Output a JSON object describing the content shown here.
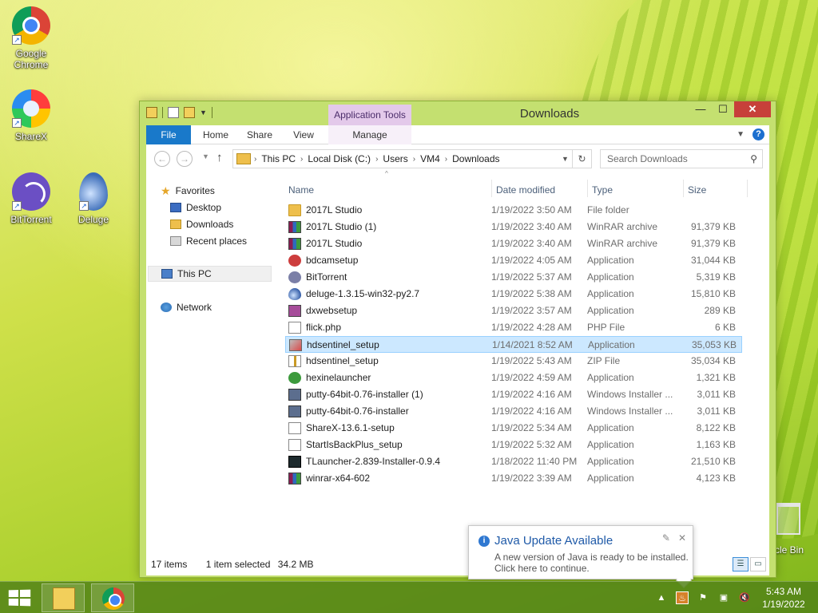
{
  "desktop": {
    "icons": [
      {
        "label": "Google\nChrome",
        "icon": "chrome-icon"
      },
      {
        "label": "ShareX",
        "icon": "sharex-icon"
      },
      {
        "label": "BitTorrent",
        "icon": "bittorrent-icon"
      },
      {
        "label": "Deluge",
        "icon": "deluge-icon"
      }
    ],
    "recycle_bin_label": "cle Bin"
  },
  "window": {
    "title": "Downloads",
    "context_tab": "Application Tools",
    "ribbon_tabs": [
      "File",
      "Home",
      "Share",
      "View",
      "Manage"
    ],
    "address_crumbs": [
      "This PC",
      "Local Disk (C:)",
      "Users",
      "VM4",
      "Downloads"
    ],
    "search_placeholder": "Search Downloads",
    "nav": {
      "favorites": "Favorites",
      "desktop": "Desktop",
      "downloads": "Downloads",
      "recent": "Recent places",
      "thispc": "This PC",
      "network": "Network"
    },
    "columns": [
      "Name",
      "Date modified",
      "Type",
      "Size"
    ],
    "files": [
      {
        "name": "2017L Studio",
        "date": "1/19/2022 3:50 AM",
        "type": "File folder",
        "size": "",
        "icon": "folder"
      },
      {
        "name": "2017L Studio (1)",
        "date": "1/19/2022 3:40 AM",
        "type": "WinRAR archive",
        "size": "91,379 KB",
        "icon": "rar"
      },
      {
        "name": "2017L Studio",
        "date": "1/19/2022 3:40 AM",
        "type": "WinRAR archive",
        "size": "91,379 KB",
        "icon": "rar"
      },
      {
        "name": "bdcamsetup",
        "date": "1/19/2022 4:05 AM",
        "type": "Application",
        "size": "31,044 KB",
        "icon": "app"
      },
      {
        "name": "BitTorrent",
        "date": "1/19/2022 5:37 AM",
        "type": "Application",
        "size": "5,319 KB",
        "icon": "bt"
      },
      {
        "name": "deluge-1.3.15-win32-py2.7",
        "date": "1/19/2022 5:38 AM",
        "type": "Application",
        "size": "15,810 KB",
        "icon": "drop"
      },
      {
        "name": "dxwebsetup",
        "date": "1/19/2022 3:57 AM",
        "type": "Application",
        "size": "289 KB",
        "icon": "dx"
      },
      {
        "name": "flick.php",
        "date": "1/19/2022 4:28 AM",
        "type": "PHP File",
        "size": "6 KB",
        "icon": "doc"
      },
      {
        "name": "hdsentinel_setup",
        "date": "1/14/2021 8:52 AM",
        "type": "Application",
        "size": "35,053 KB",
        "icon": "hd",
        "selected": true
      },
      {
        "name": "hdsentinel_setup",
        "date": "1/19/2022 5:43 AM",
        "type": "ZIP File",
        "size": "35,034 KB",
        "icon": "zip"
      },
      {
        "name": "hexinelauncher",
        "date": "1/19/2022 4:59 AM",
        "type": "Application",
        "size": "1,321 KB",
        "icon": "hex"
      },
      {
        "name": "putty-64bit-0.76-installer (1)",
        "date": "1/19/2022 4:16 AM",
        "type": "Windows Installer ...",
        "size": "3,011 KB",
        "icon": "msi"
      },
      {
        "name": "putty-64bit-0.76-installer",
        "date": "1/19/2022 4:16 AM",
        "type": "Windows Installer ...",
        "size": "3,011 KB",
        "icon": "msi"
      },
      {
        "name": "ShareX-13.6.1-setup",
        "date": "1/19/2022 5:34 AM",
        "type": "Application",
        "size": "8,122 KB",
        "icon": "dl"
      },
      {
        "name": "StartIsBackPlus_setup",
        "date": "1/19/2022 5:32 AM",
        "type": "Application",
        "size": "1,163 KB",
        "icon": "doc"
      },
      {
        "name": "TLauncher-2.839-Installer-0.9.4",
        "date": "1/18/2022 11:40 PM",
        "type": "Application",
        "size": "21,510 KB",
        "icon": "tl"
      },
      {
        "name": "winrar-x64-602",
        "date": "1/19/2022 3:39 AM",
        "type": "Application",
        "size": "4,123 KB",
        "icon": "rar"
      }
    ],
    "status": {
      "items": "17 items",
      "selected": "1 item selected",
      "size": "34.2 MB"
    }
  },
  "toast": {
    "title": "Java Update Available",
    "message": "A new version of Java is ready to be installed. Click here to continue."
  },
  "clock": {
    "time": "5:43 AM",
    "date": "1/19/2022"
  }
}
